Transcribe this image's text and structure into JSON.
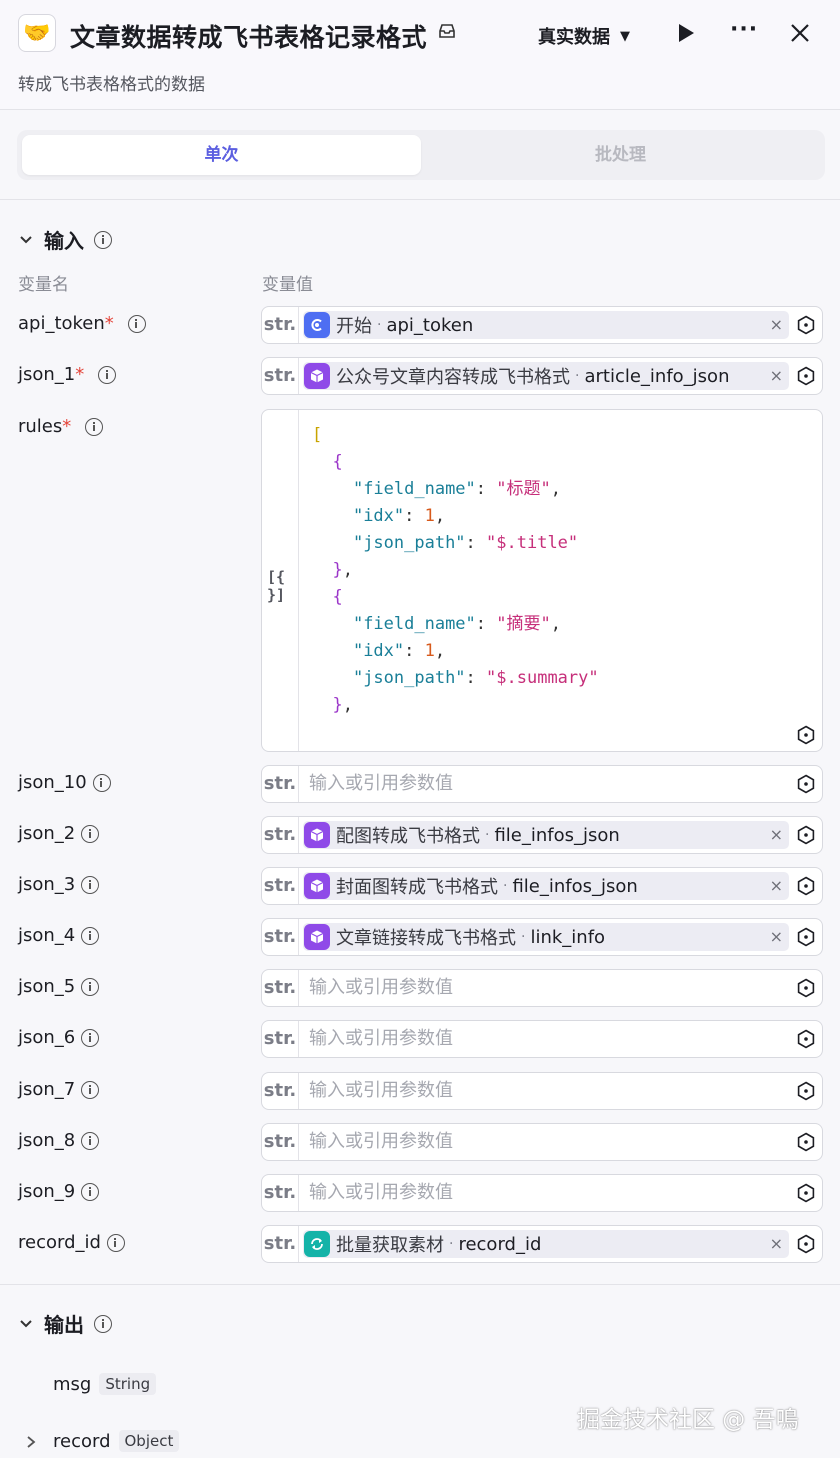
{
  "header": {
    "title": "文章数据转成飞书表格记录格式",
    "subtitle": "转成飞书表格格式的数据",
    "data_select": "真实数据",
    "app_icon": "handshake-icon"
  },
  "mode_tabs": [
    {
      "label": "单次",
      "active": true
    },
    {
      "label": "批处理",
      "active": false
    }
  ],
  "input": {
    "section_label": "输入",
    "col_name": "变量名",
    "col_value": "变量值",
    "type_label": "str.",
    "rows": [
      {
        "name": "api_token",
        "required": true,
        "node": "开始",
        "var": "api_token",
        "icon": "start-icon",
        "color": "blue"
      },
      {
        "name": "json_1",
        "required": true,
        "node": "公众号文章内容转成飞书格式",
        "var": "article_info_json",
        "icon": "cube-icon",
        "color": "purple"
      },
      {
        "name": "rules",
        "required": true,
        "code": true
      },
      {
        "name": "json_10",
        "required": false,
        "placeholder": "输入或引用参数值"
      },
      {
        "name": "json_2",
        "required": false,
        "node": "配图转成飞书格式",
        "var": "file_infos_json",
        "icon": "cube-icon",
        "color": "purple"
      },
      {
        "name": "json_3",
        "required": false,
        "node": "封面图转成飞书格式",
        "var": "file_infos_json",
        "icon": "cube-icon",
        "color": "purple"
      },
      {
        "name": "json_4",
        "required": false,
        "node": "文章链接转成飞书格式",
        "var": "link_info",
        "icon": "cube-icon",
        "color": "purple"
      },
      {
        "name": "json_5",
        "required": false,
        "placeholder": "输入或引用参数值"
      },
      {
        "name": "json_6",
        "required": false,
        "placeholder": "输入或引用参数值"
      },
      {
        "name": "json_7",
        "required": false,
        "placeholder": "输入或引用参数值"
      },
      {
        "name": "json_8",
        "required": false,
        "placeholder": "输入或引用参数值"
      },
      {
        "name": "json_9",
        "required": false,
        "placeholder": "输入或引用参数值"
      },
      {
        "name": "record_id",
        "required": false,
        "node": "批量获取素材",
        "var": "record_id",
        "icon": "loop-icon",
        "color": "teal"
      }
    ],
    "rules_code": {
      "gutter_label": "[{ }]",
      "items": [
        {
          "field_name": "标题",
          "idx": 1,
          "json_path": "$.title"
        },
        {
          "field_name": "摘要",
          "idx": 1,
          "json_path": "$.summary"
        }
      ]
    }
  },
  "output": {
    "section_label": "输出",
    "items": [
      {
        "name": "msg",
        "type": "String",
        "expandable": false
      },
      {
        "name": "record",
        "type": "Object",
        "expandable": true
      }
    ]
  },
  "watermark": "掘金技术社区 @ 吾鳴"
}
